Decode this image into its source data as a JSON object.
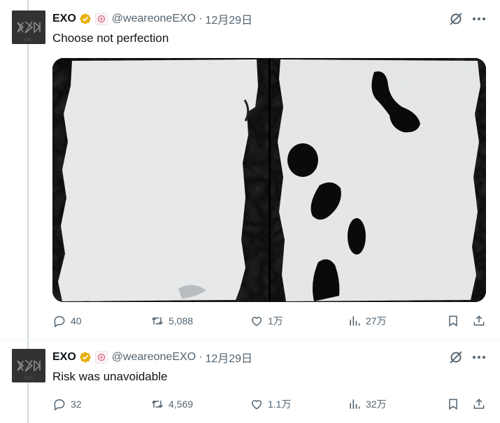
{
  "tweets": [
    {
      "author": {
        "name": "EXO",
        "handle": "@weareoneEXO",
        "date": "12月29日",
        "avatar_text": "EXO"
      },
      "text": "Choose not perfection",
      "has_media": true,
      "stats": {
        "replies": "40",
        "retweets": "5,088",
        "likes": "1万",
        "views": "27万"
      }
    },
    {
      "author": {
        "name": "EXO",
        "handle": "@weareoneEXO",
        "date": "12月29日",
        "avatar_text": "EXO"
      },
      "text": "Risk was unavoidable",
      "has_media": false,
      "stats": {
        "replies": "32",
        "retweets": "4,569",
        "likes": "1.1万",
        "views": "32万"
      }
    }
  ],
  "header_separator": "·",
  "colors": {
    "text": "#0f1419",
    "muted": "#536471",
    "verified": "#e8b00f",
    "thread_line": "#cfd9de"
  },
  "icons": [
    "verified-badge-icon",
    "affiliate-badge-icon",
    "grok-icon",
    "more-icon",
    "reply-icon",
    "retweet-icon",
    "like-icon",
    "views-icon",
    "bookmark-icon",
    "share-icon"
  ]
}
